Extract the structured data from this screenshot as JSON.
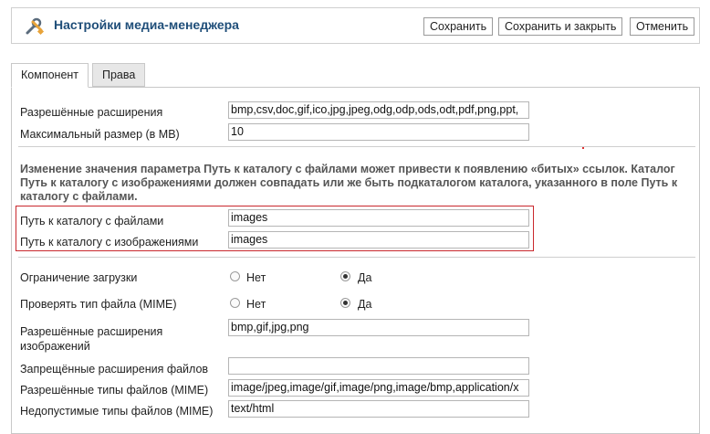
{
  "header": {
    "title": "Настройки медиа-менеджера",
    "logo_icon": "tools-icon",
    "buttons": {
      "save": "Сохранить",
      "save_close": "Сохранить и закрыть",
      "cancel": "Отменить"
    }
  },
  "tabs": [
    {
      "label": "Компонент",
      "active": true
    },
    {
      "label": "Права",
      "active": false
    }
  ],
  "fields": {
    "allowed_extensions": {
      "label": "Разрешённые расширения",
      "value": "bmp,csv,doc,gif,ico,jpg,jpeg,odg,odp,ods,odt,pdf,png,ppt,"
    },
    "max_size": {
      "label": "Максимальный размер (в MB)",
      "value": "10"
    },
    "note": "Изменение значения параметра Путь к каталогу с файлами может привести к появлению «битых» ссылок. Каталог Путь к каталогу с изображениями должен совпадать или же быть подкаталогом каталога, указанного в поле Путь к каталогу с файлами.",
    "file_path": {
      "label": "Путь к каталогу с файлами",
      "value": "images"
    },
    "image_path": {
      "label": "Путь к каталогу с изображениями",
      "value": "images"
    },
    "upload_restrict": {
      "label": "Ограничение загрузки",
      "no": "Нет",
      "yes": "Да",
      "selected": "yes"
    },
    "check_mime": {
      "label": "Проверять тип файла (MIME)",
      "no": "Нет",
      "yes": "Да",
      "selected": "yes"
    },
    "image_extensions": {
      "label_line1": "Разрешённые расширения",
      "label_line2": "изображений",
      "value": "bmp,gif,jpg,png"
    },
    "ignored_extensions": {
      "label": "Запрещённые расширения файлов",
      "value": ""
    },
    "allowed_mime": {
      "label": "Разрешённые типы файлов (MIME)",
      "value": "image/jpeg,image/gif,image/png,image/bmp,application/x"
    },
    "illegal_mime": {
      "label": "Недопустимые типы файлов (MIME)",
      "value": "text/html"
    }
  },
  "colors": {
    "title": "#1f4e79",
    "highlight_border": "#c9282d"
  }
}
